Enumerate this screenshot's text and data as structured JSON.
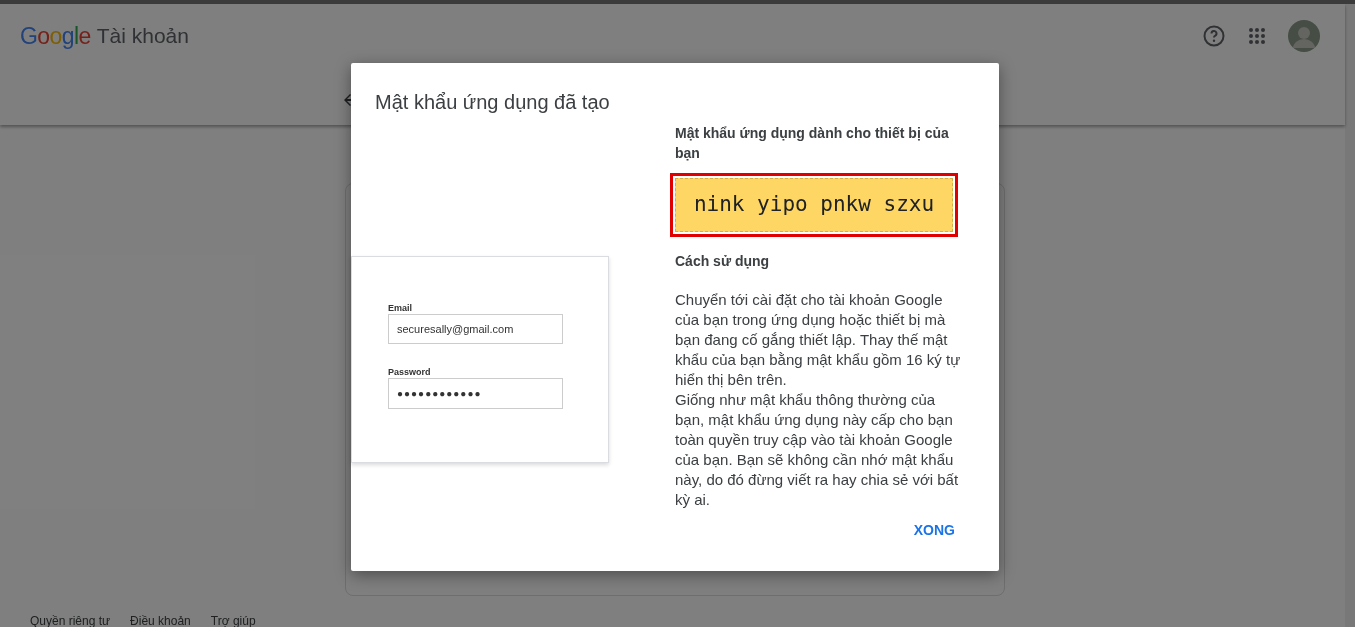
{
  "header": {
    "logo": "Google",
    "product": "Tài khoản"
  },
  "footer": {
    "links": [
      "Quyền riêng tư",
      "Điều khoản",
      "Trợ giúp"
    ]
  },
  "dialog": {
    "title": "Mật khẩu ứng dụng đã tạo",
    "illustration": {
      "email_label": "Email",
      "email_value": "securesally@gmail.com",
      "password_label": "Password",
      "password_value": "●●●●●●●●●●●●"
    },
    "password_heading": "Mật khẩu ứng dụng dành cho thiết bị của bạn",
    "app_password": "nink yipo pnkw szxu",
    "usage_heading": "Cách sử dụng",
    "usage_paragraphs": [
      "Chuyển tới cài đặt cho tài khoản Google của bạn trong ứng dụng hoặc thiết bị mà bạn đang cố gắng thiết lập. Thay thế mật khẩu của bạn bằng mật khẩu gồm 16 ký tự hiển thị bên trên.",
      "Giống như mật khẩu thông thường của bạn, mật khẩu ứng dụng này cấp cho bạn toàn quyền truy cập vào tài khoản Google của bạn. Bạn sẽ không cần nhớ mật khẩu này, do đó đừng viết ra hay chia sẻ với bất kỳ ai."
    ],
    "button": "XONG"
  }
}
